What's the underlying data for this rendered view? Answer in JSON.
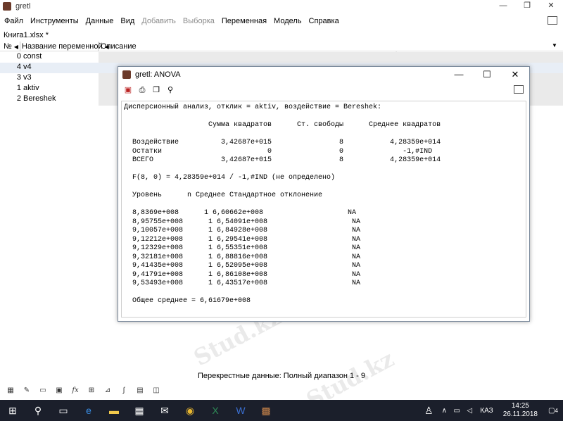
{
  "window": {
    "title": "gretl",
    "controls": [
      "—",
      "❐",
      "✕"
    ]
  },
  "menu": [
    {
      "label": "Файл",
      "disabled": false
    },
    {
      "label": "Инструменты",
      "disabled": false
    },
    {
      "label": "Данные",
      "disabled": false
    },
    {
      "label": "Вид",
      "disabled": false
    },
    {
      "label": "Добавить",
      "disabled": true
    },
    {
      "label": "Выборка",
      "disabled": true
    },
    {
      "label": "Переменная",
      "disabled": false
    },
    {
      "label": "Модель",
      "disabled": false
    },
    {
      "label": "Справка",
      "disabled": false
    }
  ],
  "file_label": "Книга1.xlsx *",
  "columns": {
    "num": "№",
    "name": "Название переменной",
    "desc": "Описание"
  },
  "variables": [
    {
      "num": "0",
      "name": "const"
    },
    {
      "num": "4",
      "name": "v4"
    },
    {
      "num": "3",
      "name": "v3"
    },
    {
      "num": "1",
      "name": "aktiv"
    },
    {
      "num": "2",
      "name": "Bereshek"
    }
  ],
  "status": "Перекрестные данные: Полный диапазон 1 - 9",
  "dialog": {
    "title": "gretl: ANOVA",
    "controls": [
      "—",
      "☐",
      "✕"
    ],
    "output": [
      "Дисперсионный анализ, отклик = aktiv, воздействие = Bereshek:",
      "",
      "                    Сумма квадратов      Ст. свободы      Среднее квадратов",
      "",
      "  Воздействие          3,42687e+015                8           4,28359e+014",
      "  Остатки                         0                0              -1,#IND",
      "  ВСЕГО                3,42687e+015                8           4,28359e+014",
      "",
      "  F(8, 0) = 4,28359e+014 / -1,#IND (не определено)",
      "",
      "  Уровень      n Среднее Стандартное отклонение",
      "",
      "  8,8369e+008      1 6,60662e+008                    NA",
      "  8,95755e+008      1 6,54091e+008                    NA",
      "  9,10057e+008      1 6,84928e+008                    NA",
      "  9,12212e+008      1 6,29541e+008                    NA",
      "  9,12329e+008      1 6,55351e+008                    NA",
      "  9,32181e+008      1 6,88816e+008                    NA",
      "  9,41435e+008      1 6,52095e+008                    NA",
      "  9,41791e+008      1 6,86108e+008                    NA",
      "  9,53493e+008      1 6,43517e+008                    NA",
      "",
      "  Общее среднее = 6,61679e+008"
    ]
  },
  "taskbar": {
    "lang": "КАЗ",
    "time": "14:25",
    "date": "26.11.2018",
    "notifications": "4"
  },
  "watermark": "Stud.kz"
}
